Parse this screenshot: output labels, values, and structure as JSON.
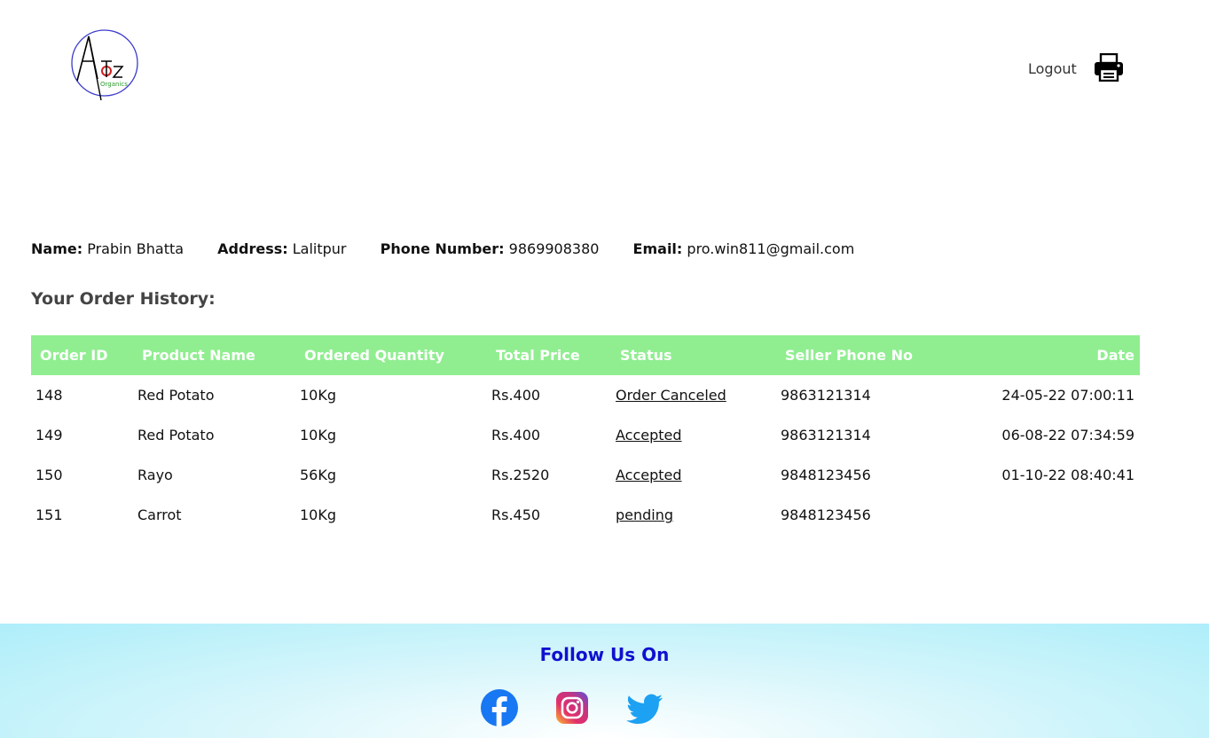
{
  "header": {
    "logo_alt": "AtoZ Organics",
    "logo_main": "Atoz",
    "logo_sub": "Organics",
    "logout_label": "Logout",
    "print_icon": "printer-icon"
  },
  "user": {
    "name_label": "Name:",
    "name_value": "Prabin Bhatta",
    "address_label": "Address:",
    "address_value": "Lalitpur",
    "phone_label": "Phone Number:",
    "phone_value": "9869908380",
    "email_label": "Email:",
    "email_value": "pro.win811@gmail.com"
  },
  "orders": {
    "title": "Your Order History:",
    "columns": [
      "Order ID",
      "Product Name",
      "Ordered Quantity",
      "Total Price",
      "Status",
      "Seller Phone No",
      "Date"
    ],
    "rows": [
      [
        "148",
        "Red Potato",
        "10Kg",
        "Rs.400",
        "Order Canceled",
        "9863121314",
        "24-05-22 07:00:11"
      ],
      [
        "149",
        "Red Potato",
        "10Kg",
        "Rs.400",
        "Accepted",
        "9863121314",
        "06-08-22 07:34:59"
      ],
      [
        "150",
        "Rayo",
        "56Kg",
        "Rs.2520",
        "Accepted",
        "9848123456",
        "01-10-22 08:40:41"
      ],
      [
        "151",
        "Carrot",
        "10Kg",
        "Rs.450",
        "pending",
        "9848123456",
        ""
      ]
    ]
  },
  "footer": {
    "follow_label": "Follow Us On",
    "social": [
      "facebook-icon",
      "instagram-icon",
      "twitter-icon"
    ]
  },
  "colors": {
    "table_header": "#90ee90",
    "follow_text": "#1010d0",
    "footer_bg": "#aeeefa"
  }
}
